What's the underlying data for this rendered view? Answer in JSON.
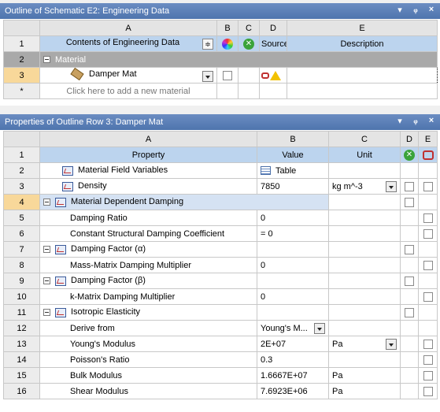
{
  "outline": {
    "title": "Outline of Schematic E2: Engineering Data",
    "col_letters": [
      "A",
      "B",
      "C",
      "D",
      "E"
    ],
    "header": {
      "row": "1",
      "contents": "Contents of Engineering Data",
      "source": "Source",
      "description": "Description"
    },
    "category": {
      "row": "2",
      "label": "Material"
    },
    "material": {
      "row": "3",
      "name": "Damper Mat"
    },
    "add_row": {
      "row": "*",
      "placeholder": "Click here to add a new material"
    }
  },
  "properties": {
    "title": "Properties of Outline Row 3: Damper Mat",
    "col_letters": [
      "A",
      "B",
      "C",
      "D",
      "E"
    ],
    "header": {
      "row": "1",
      "property": "Property",
      "value": "Value",
      "unit": "Unit"
    },
    "rows": [
      {
        "num": "2",
        "label": "Material Field Variables",
        "value": "Table",
        "unit": ""
      },
      {
        "num": "3",
        "label": "Density",
        "value": "7850",
        "unit": "kg m^-3"
      },
      {
        "num": "4",
        "label": "Material Dependent Damping",
        "value": "",
        "unit": ""
      },
      {
        "num": "5",
        "label": "Damping Ratio",
        "value": "0",
        "unit": ""
      },
      {
        "num": "6",
        "label": "Constant Structural Damping Coefficient",
        "value": "= 0",
        "unit": ""
      },
      {
        "num": "7",
        "label": "Damping Factor (α)",
        "value": "",
        "unit": ""
      },
      {
        "num": "8",
        "label": "Mass-Matrix Damping Multiplier",
        "value": "0",
        "unit": ""
      },
      {
        "num": "9",
        "label": "Damping Factor (β)",
        "value": "",
        "unit": ""
      },
      {
        "num": "10",
        "label": "k-Matrix Damping Multiplier",
        "value": "0",
        "unit": ""
      },
      {
        "num": "11",
        "label": "Isotropic Elasticity",
        "value": "",
        "unit": ""
      },
      {
        "num": "12",
        "label": "Derive from",
        "value": "Young's M...",
        "unit": ""
      },
      {
        "num": "13",
        "label": "Young's Modulus",
        "value": "2E+07",
        "unit": "Pa"
      },
      {
        "num": "14",
        "label": "Poisson's Ratio",
        "value": "0.3",
        "unit": ""
      },
      {
        "num": "15",
        "label": "Bulk Modulus",
        "value": "1.6667E+07",
        "unit": "Pa"
      },
      {
        "num": "16",
        "label": "Shear Modulus",
        "value": "7.6923E+06",
        "unit": "Pa"
      }
    ]
  },
  "colors": {
    "titlebar": "#5a7fb4",
    "selected_row": "#f8d89a",
    "category": "#a9a9a9",
    "header_blue": "#bcd4ee"
  }
}
